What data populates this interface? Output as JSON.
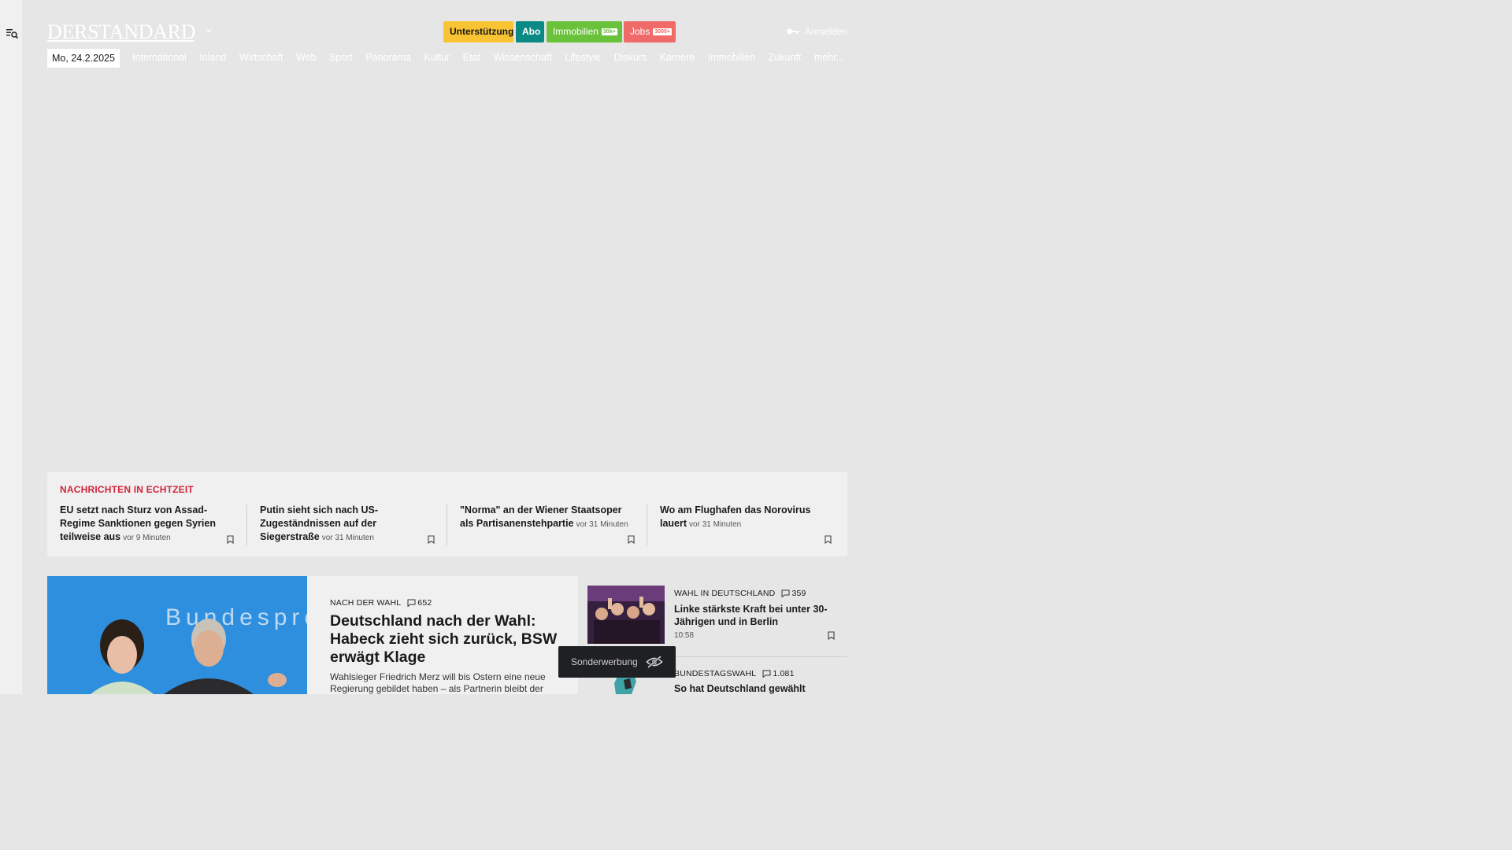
{
  "header": {
    "logo_text": "DERSTANDARD",
    "buttons": {
      "support": "Unterstützung",
      "abo": "Abo",
      "immobilien": "Immobilien",
      "immobilien_badge": "30k+",
      "jobs": "Jobs",
      "jobs_badge": "3000+"
    },
    "login": "Anmelden",
    "date": "Mo, 24.2.2025",
    "nav": [
      "International",
      "Inland",
      "Wirtschaft",
      "Web",
      "Sport",
      "Panorama",
      "Kultur",
      "Etat",
      "Wissenschaft",
      "Lifestyle",
      "Diskurs",
      "Karriere",
      "Immobilien",
      "Zukunft",
      "mehr..."
    ]
  },
  "ticker": {
    "title": "NACHRICHTEN IN ECHTZEIT",
    "items": [
      {
        "title": "EU setzt nach Sturz von Assad-Regime Sanktionen gegen Syrien teilweise aus",
        "time": "vor 9 Minuten"
      },
      {
        "title": "Putin sieht sich nach US-Zugeständnissen auf der Siegerstraße",
        "time": "vor 31 Minuten"
      },
      {
        "title": "\"Norma\" an der Wiener Staatsoper als Partisanenstehpartie",
        "time": "vor 31 Minuten"
      },
      {
        "title": "Wo am Flughafen das Norovirus lauert",
        "time": "vor 31 Minuten"
      }
    ]
  },
  "main_story": {
    "kicker": "NACH DER WAHL",
    "comments": "652",
    "headline": "Deutschland nach der Wahl: Habeck zieht sich zurück, BSW erwägt Klage",
    "teaser": "Wahlsieger Friedrich Merz will bis Ostern eine neue Regierung gebildet haben – als Partnerin bleibt der",
    "photo_text": "Bundespre"
  },
  "side_stories": [
    {
      "kicker": "WAHL IN DEUTSCHLAND",
      "comments": "359",
      "title": "Linke stärkste Kraft bei unter 30-Jährigen und in Berlin",
      "time": "10:58"
    },
    {
      "kicker": "BUNDESTAGSWAHL",
      "comments": "1.081",
      "title": "So hat Deutschland gewählt"
    }
  ],
  "overlay": {
    "label": "Sonderwerbung"
  },
  "colors": {
    "ticker_title": "#d1233b",
    "support": "#f8c433",
    "abo": "#0b8a85",
    "immobilien": "#6ac23b",
    "jobs": "#f06a6a",
    "photo_bg": "#2f8fdf"
  },
  "icons": [
    "menu-search-icon",
    "chevron-down-icon",
    "key-icon",
    "bookmark-icon",
    "comment-icon",
    "eye-off-icon"
  ]
}
